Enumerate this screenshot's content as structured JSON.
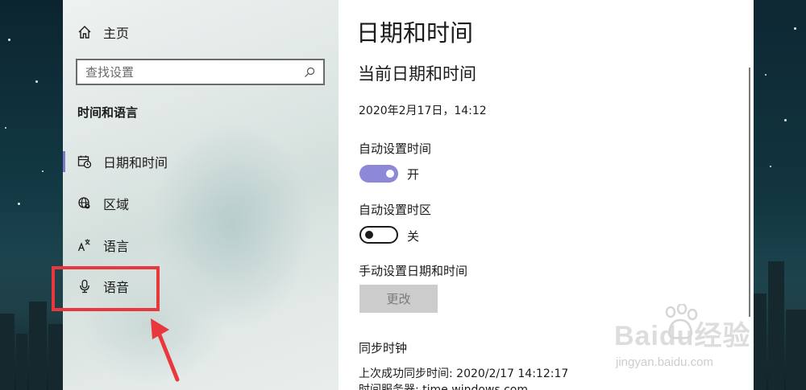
{
  "nav": {
    "home_label": "主页",
    "search_placeholder": "查找设置",
    "section_title": "时间和语言",
    "items": [
      {
        "label": "日期和时间",
        "icon": "calendar-clock-icon",
        "selected": true
      },
      {
        "label": "区域",
        "icon": "globe-icon",
        "selected": false
      },
      {
        "label": "语言",
        "icon": "language-icon",
        "selected": false
      },
      {
        "label": "语音",
        "icon": "microphone-icon",
        "selected": false
      }
    ],
    "accent_color": "#7e78c8"
  },
  "main": {
    "page_title": "日期和时间",
    "current_heading": "当前日期和时间",
    "current_datetime": "2020年2月17日，14:12",
    "auto_time_label": "自动设置时间",
    "auto_time_state": "开",
    "auto_zone_label": "自动设置时区",
    "auto_zone_state": "关",
    "manual_label": "手动设置日期和时间",
    "change_button": "更改",
    "sync_heading": "同步时钟",
    "last_sync": "上次成功同步时间: 2020/2/17 14:12:17",
    "time_server": "时间服务器: time.windows.com"
  },
  "watermark": {
    "brand": "Baidu经验",
    "url": "jingyan.baidu.com"
  },
  "annotation_color": "#e8383d"
}
